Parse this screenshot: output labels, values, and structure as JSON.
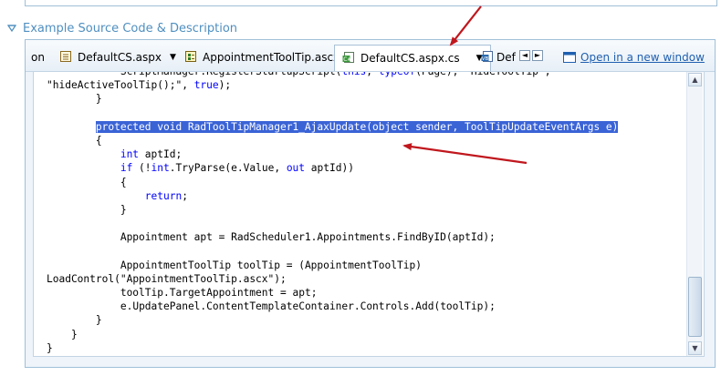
{
  "section": {
    "title": "Example Source Code & Description"
  },
  "tabs": [
    {
      "label": "on",
      "icon": "none"
    },
    {
      "label": "DefaultCS.aspx",
      "icon": "aspx-page-icon"
    },
    {
      "label": "AppointmentToolTip.ascx",
      "icon": "ascx-control-icon"
    },
    {
      "label": "DefaultCS.aspx.cs",
      "icon": "cs-file-icon",
      "active": true
    },
    {
      "label": "Def",
      "icon": "vb-file-icon"
    }
  ],
  "nav": {
    "prev": "◄",
    "next": "►"
  },
  "open_link": "Open in a new window",
  "code": {
    "lines": [
      "            ScriptManager.RegisterStartupScript(this, typeof(Page), \"HideToolTip\",",
      "\"hideActiveToolTip();\", true);",
      "        }",
      "",
      "        protected void RadToolTipManager1_AjaxUpdate(object sender, ToolTipUpdateEventArgs e)",
      "        {",
      "            int aptId;",
      "            if (!int.TryParse(e.Value, out aptId))",
      "            {",
      "                return;",
      "            }",
      "",
      "            Appointment apt = RadScheduler1.Appointments.FindByID(aptId);",
      "",
      "            AppointmentToolTip toolTip = (AppointmentToolTip)",
      "LoadControl(\"AppointmentToolTip.ascx\");",
      "            toolTip.TargetAppointment = apt;",
      "            e.UpdatePanel.ContentTemplateContainer.Controls.Add(toolTip);",
      "        }",
      "    }",
      "}"
    ]
  },
  "colors": {
    "accent": "#4f8fc0",
    "selection": "#3a63d6",
    "keyword": "#0000ff",
    "annotation_arrow": "#c0171d",
    "link": "#2060b0"
  }
}
